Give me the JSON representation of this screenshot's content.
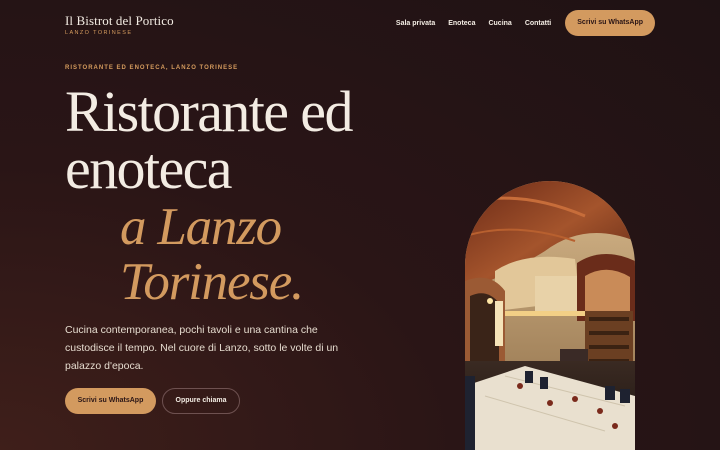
{
  "header": {
    "brand_name": "Il Bistrot del Portico",
    "brand_sub": "LANZO TORINESE",
    "nav": [
      "Sala privata",
      "Enoteca",
      "Cucina",
      "Contatti"
    ],
    "cta": "Scrivi su WhatsApp"
  },
  "hero": {
    "eyebrow": "RISTORANTE ED ENOTECA, LANZO TORINESE",
    "title_line1": "Ristorante ed",
    "title_line2": "enoteca",
    "title_accent_line1": "a Lanzo",
    "title_accent_line2": "Torinese.",
    "lead": "Cucina contemporanea, pochi tavoli e una cantina che custodisce il tempo. Nel cuore di Lanzo, sotto le volte di un palazzo d'epoca.",
    "primary_button": "Scrivi su WhatsApp",
    "secondary_button": "Oppure chiama"
  },
  "colors": {
    "background": "#231416",
    "accent": "#d39a5f",
    "text": "#f3ece3"
  }
}
